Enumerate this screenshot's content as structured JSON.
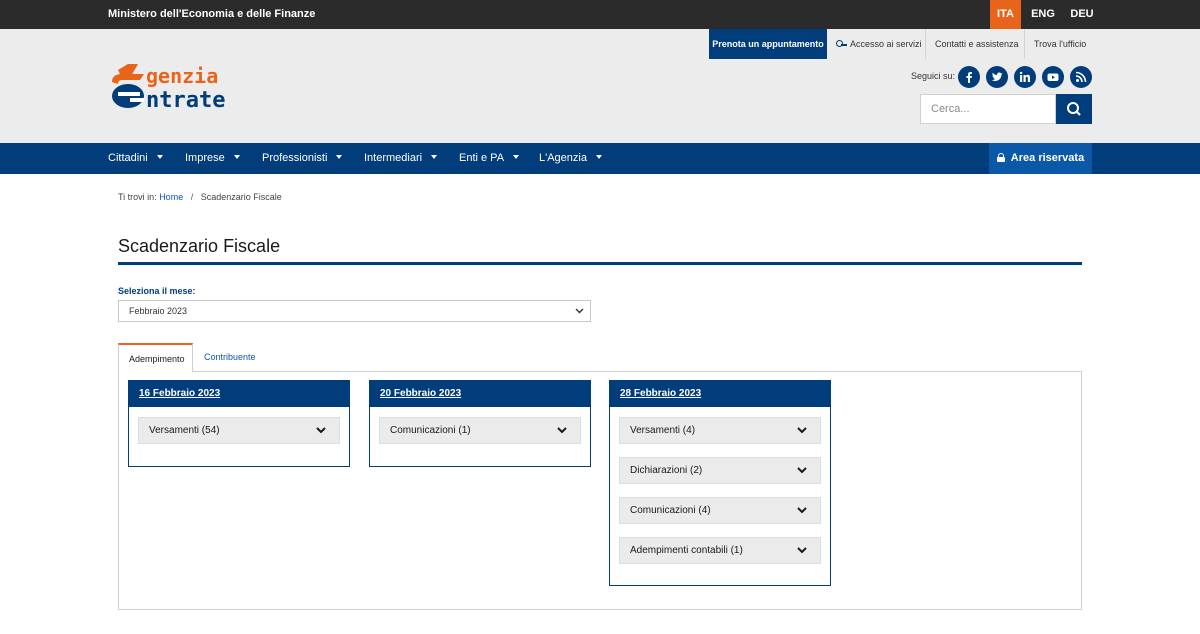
{
  "topbar": {
    "ministry": "Ministero dell'Economia e delle Finanze",
    "languages": [
      "ITA",
      "ENG",
      "DEU"
    ],
    "active_language": "ITA"
  },
  "header": {
    "logo_text": [
      "genzia",
      "ntrate"
    ],
    "utility_links": {
      "prenota": "Prenota un appuntamento",
      "accesso": "Accesso ai servizi",
      "contatti": "Contatti e assistenza",
      "trova": "Trova l'ufficio"
    },
    "seguici": "Seguici su:",
    "search_placeholder": "Cerca...",
    "social": [
      "facebook-icon",
      "twitter-icon",
      "linkedin-icon",
      "youtube-icon",
      "rss-icon"
    ]
  },
  "nav": {
    "items": [
      "Cittadini",
      "Imprese",
      "Professionisti",
      "Intermediari",
      "Enti e PA",
      "L'Agenzia"
    ],
    "area_riservata": "Area riservata"
  },
  "breadcrumb": {
    "prefix": "Ti trovi in:",
    "home": "Home",
    "current": "Scadenzario Fiscale"
  },
  "page": {
    "title": "Scadenzario Fiscale",
    "select_label": "Seleziona il mese:",
    "selected_month": "Febbraio 2023"
  },
  "tabs": [
    "Adempimento",
    "Contribuente"
  ],
  "cards": [
    {
      "date": "16 Febbraio 2023",
      "items": [
        "Versamenti (54)"
      ]
    },
    {
      "date": "20 Febbraio 2023",
      "items": [
        "Comunicazioni (1)"
      ]
    },
    {
      "date": "28 Febbraio 2023",
      "items": [
        "Versamenti (4)",
        "Dichiarazioni (2)",
        "Comunicazioni (4)",
        "Adempimenti contabili (1)"
      ]
    }
  ],
  "colors": {
    "primary": "#003d7a",
    "accent": "#e8641b",
    "topbar": "#2b2b2b",
    "header_bg": "#ececec"
  }
}
